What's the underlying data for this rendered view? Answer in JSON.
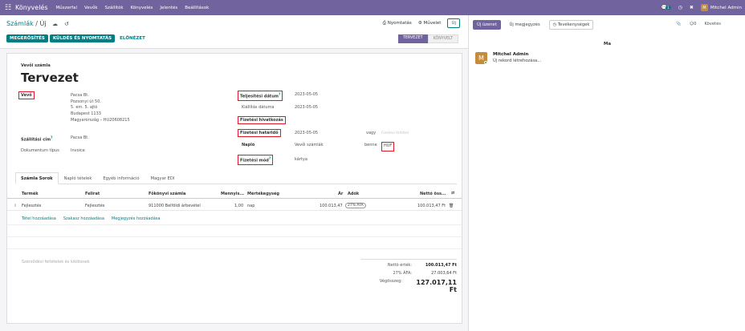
{
  "topbar": {
    "brand": "Könyvelés",
    "menu": [
      "Műszerfal",
      "Vevők",
      "Szállítók",
      "Könyvelés",
      "Jelentés",
      "Beállítások"
    ],
    "chat_badge": "1",
    "user": "Mitchel Admin",
    "user_initial": "M"
  },
  "control": {
    "breadcrumb_parent": "Számlák",
    "breadcrumb_sep": " / ",
    "breadcrumb_current": "Új",
    "print_label": "Nyomtatás",
    "action_label": "Művelet",
    "new_label": "Új",
    "buttons": {
      "confirm": "MEGERŐSÍTÉS",
      "send_print": "KÜLDÉS ÉS NYOMTATÁS",
      "preview": "ELŐNÉZET"
    },
    "status": {
      "active": "TERVEZET",
      "next": "KÖNYVELT"
    }
  },
  "form": {
    "invoice_type": "Vevői számla",
    "title": "Tervezet",
    "customer_label": "Vevő",
    "customer": {
      "name": "Pacsa Bt.",
      "street": "Pozsonyi út 50.",
      "street2": "5. em. 5. ajtó",
      "city": "Budapest 1133",
      "country_vat": "Magyarország – HU20608215"
    },
    "shipping_label": "Szállítási cím",
    "shipping_value": "Pacsa Bt.",
    "doctype_label": "Dokumentum típus",
    "doctype_value": "Invoice",
    "delivery_date_label": "Teljesítési dátum",
    "delivery_date_value": "2023-05-05",
    "issue_date_label": "Kiállítás dátuma",
    "issue_date_value": "2023-05-05",
    "payment_ref_label": "Fizetési hivatkozás",
    "due_date_label": "Fizetési határidő",
    "due_date_value": "2023-05-05",
    "or_label": "vagy",
    "payment_terms_placeholder": "Fizetési feltétel",
    "journal_label": "Napló",
    "journal_value": "Vevői számlák",
    "in_label": "benne",
    "currency": "HUF",
    "payment_method_label": "Fizetési mód",
    "payment_method_value": "kártya",
    "sup_mark": "?"
  },
  "tabs": [
    "Számla Sorok",
    "Napló tételek",
    "Egyéb információ",
    "Magyar EDI"
  ],
  "table": {
    "headers": {
      "product": "Termék",
      "label": "Felirat",
      "account": "Főkönyvi számla",
      "qty": "Mennyis...",
      "uom": "Mértékegység",
      "price": "Ár",
      "taxes": "Adók",
      "subtotal": "Nettó öss..."
    },
    "row": {
      "product": "Fejlesztés",
      "label": "Fejlesztés",
      "account": "911000 Belföldi árbevétel",
      "qty": "1,00",
      "uom": "nap",
      "price": "100.013,47",
      "tax": "27% ÁFA",
      "subtotal": "100.013,47 Ft"
    },
    "add_line": "Tétel hozzáadása",
    "add_section": "Szakasz hozzáadása",
    "add_note": "Megjegyzés hozzáadása"
  },
  "terms_placeholder": "Szerződési feltételek és kikötések",
  "totals": {
    "net_label": "Nettó érték:",
    "net_value": "100.013,47 Ft",
    "vat_label": "27% ÁFA:",
    "vat_value": "27.003,64 Ft",
    "total_label": "Végösszeg:",
    "total_value": "127.017,11 Ft"
  },
  "chatter": {
    "new_message": "Új üzenet",
    "new_note": "Új megjegyzés",
    "activities": "Tevékenységek",
    "followers_count": "0",
    "follow": "Követés",
    "date_sep": "Ma",
    "author": "Mitchel Admin",
    "author_initial": "M",
    "body": "Új rekord létrehozása..."
  },
  "colors": {
    "topbar": "#71639e",
    "primary": "#017e84",
    "highlight": "#e0182a"
  }
}
